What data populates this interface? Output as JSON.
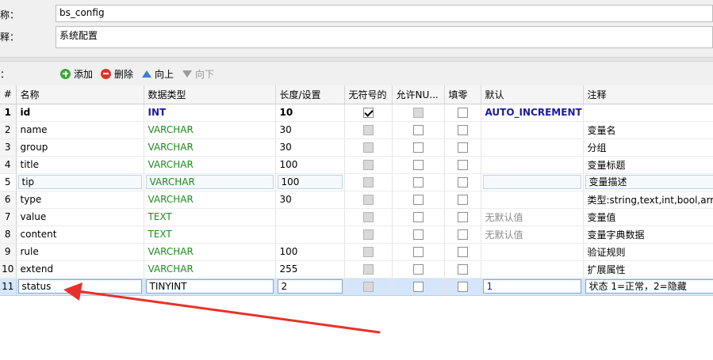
{
  "form": {
    "name_label": "称：",
    "name_value": "bs_config",
    "comment_label": "释：",
    "comment_value": "系统配置",
    "fields_label": "："
  },
  "toolbar": {
    "add_label": "添加",
    "delete_label": "删除",
    "up_label": "向上",
    "down_label": "向下"
  },
  "grid": {
    "columns": {
      "num": "#",
      "name": "名称",
      "type": "数据类型",
      "length": "长度/设置",
      "unsigned": "无符号的",
      "nullable": "允许NU...",
      "zerofill": "填零",
      "default": "默认",
      "comment": "注释"
    },
    "rows": [
      {
        "num": "1",
        "name": "id",
        "type": "INT",
        "length": "10",
        "unsigned": true,
        "default": "AUTO_INCREMENT",
        "comment": ""
      },
      {
        "num": "2",
        "name": "name",
        "type": "VARCHAR",
        "length": "30",
        "unsigned": false,
        "default": "",
        "comment": "变量名"
      },
      {
        "num": "3",
        "name": "group",
        "type": "VARCHAR",
        "length": "30",
        "unsigned": false,
        "default": "",
        "comment": "分组"
      },
      {
        "num": "4",
        "name": "title",
        "type": "VARCHAR",
        "length": "100",
        "unsigned": false,
        "default": "",
        "comment": "变量标题"
      },
      {
        "num": "5",
        "name": "tip",
        "type": "VARCHAR",
        "length": "100",
        "unsigned": false,
        "default": "",
        "comment": "变量描述"
      },
      {
        "num": "6",
        "name": "type",
        "type": "VARCHAR",
        "length": "30",
        "unsigned": false,
        "default": "",
        "comment": "类型:string,text,int,bool,array"
      },
      {
        "num": "7",
        "name": "value",
        "type": "TEXT",
        "length": "",
        "unsigned": false,
        "default": "无默认值",
        "comment": "变量值"
      },
      {
        "num": "8",
        "name": "content",
        "type": "TEXT",
        "length": "",
        "unsigned": false,
        "default": "无默认值",
        "comment": "变量字典数据"
      },
      {
        "num": "9",
        "name": "rule",
        "type": "VARCHAR",
        "length": "100",
        "unsigned": false,
        "default": "",
        "comment": "验证规则"
      },
      {
        "num": "10",
        "name": "extend",
        "type": "VARCHAR",
        "length": "255",
        "unsigned": false,
        "default": "",
        "comment": "扩展属性"
      },
      {
        "num": "11",
        "name": "status",
        "type": "TINYINT",
        "length": "2",
        "unsigned": false,
        "default": "1",
        "comment": "状态 1=正常，2=隐藏"
      }
    ]
  },
  "colors": {
    "annotation_arrow": "#e8312a",
    "selection": "#d5e6fa"
  }
}
